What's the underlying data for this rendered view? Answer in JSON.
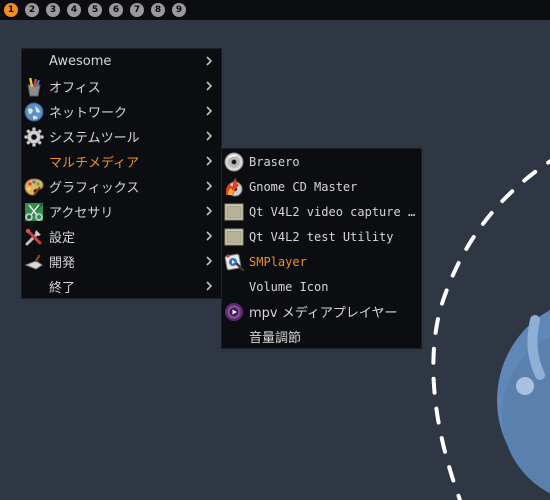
{
  "taglist": [
    {
      "label": "1",
      "active": true
    },
    {
      "label": "2",
      "active": false
    },
    {
      "label": "3",
      "active": false
    },
    {
      "label": "4",
      "active": false
    },
    {
      "label": "5",
      "active": false
    },
    {
      "label": "6",
      "active": false
    },
    {
      "label": "7",
      "active": false
    },
    {
      "label": "8",
      "active": false
    },
    {
      "label": "9",
      "active": false
    }
  ],
  "colors": {
    "accent": "#f0901e",
    "menu_bg": "#0b0d10",
    "menu_text": "#d6d6d6",
    "desktop_bg": "#2f3644"
  },
  "main_menu": {
    "items": [
      {
        "label": "Awesome",
        "icon": "none",
        "has_submenu": true
      },
      {
        "label": "オフィス",
        "icon": "office-pencils-icon",
        "has_submenu": true
      },
      {
        "label": "ネットワーク",
        "icon": "globe-icon",
        "has_submenu": true
      },
      {
        "label": "システムツール",
        "icon": "gear-icon",
        "has_submenu": true
      },
      {
        "label": "マルチメディア",
        "icon": "none",
        "has_submenu": true,
        "active": true
      },
      {
        "label": "グラフィックス",
        "icon": "palette-icon",
        "has_submenu": true
      },
      {
        "label": "アクセサリ",
        "icon": "scissors-icon",
        "has_submenu": true
      },
      {
        "label": "設定",
        "icon": "settings-tools-icon",
        "has_submenu": true
      },
      {
        "label": "開発",
        "icon": "trowel-icon",
        "has_submenu": true
      },
      {
        "label": "終了",
        "icon": "none",
        "has_submenu": true
      }
    ]
  },
  "sub_menu": {
    "items": [
      {
        "label": "Brasero",
        "icon": "disc-icon"
      },
      {
        "label": "Gnome CD Master",
        "icon": "flame-disc-icon"
      },
      {
        "label": "Qt V4L2 video capture …",
        "icon": "app-window-icon"
      },
      {
        "label": "Qt V4L2 test Utility",
        "icon": "app-window-icon"
      },
      {
        "label": "SMPlayer",
        "icon": "smplayer-icon",
        "active": true
      },
      {
        "label": "Volume Icon",
        "icon": "none"
      },
      {
        "label": "mpv メディアプレイヤー",
        "icon": "mpv-icon"
      },
      {
        "label": "音量調節",
        "icon": "none"
      }
    ]
  }
}
